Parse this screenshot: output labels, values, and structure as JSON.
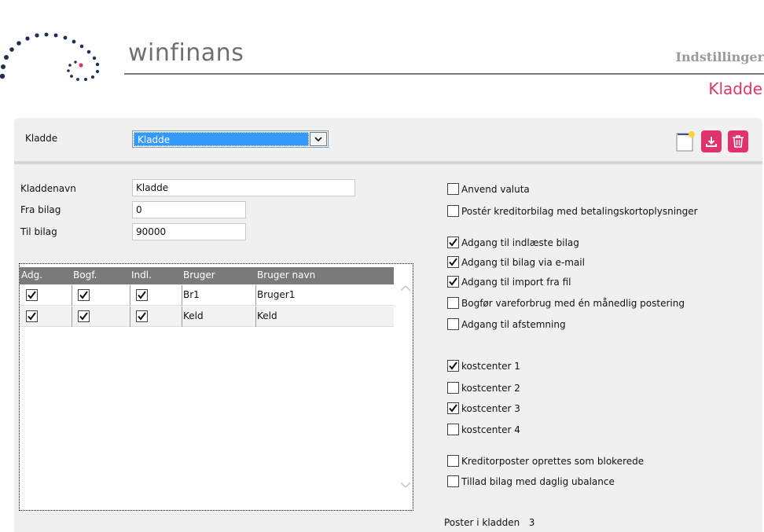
{
  "brand": {
    "name": "winfinans"
  },
  "header": {
    "section": "Indstillinger",
    "title": "Kladde"
  },
  "toolbar": {
    "kladde_label": "Kladde",
    "kladde_selected": "Kladde",
    "new_icon": "new-document-icon",
    "download_icon": "download-icon",
    "delete_icon": "trash-icon"
  },
  "form": {
    "name_label": "Kladdenavn",
    "name_value": "Kladde",
    "from_label": "Fra bilag",
    "from_value": "0",
    "to_label": "Til bilag",
    "to_value": "90000"
  },
  "table": {
    "columns": [
      "Adg.",
      "Bogf.",
      "Indl.",
      "Bruger",
      "Bruger navn"
    ],
    "rows": [
      {
        "adg": true,
        "bogf": true,
        "indl": true,
        "bruger": "Br1",
        "navn": "Bruger1"
      },
      {
        "adg": true,
        "bogf": true,
        "indl": true,
        "bruger": "Keld",
        "navn": "Keld"
      }
    ]
  },
  "options": {
    "group1": [
      {
        "label": "Anvend valuta",
        "checked": false
      },
      {
        "label": "Postér kreditorbilag med betalingskortoplysninger",
        "checked": false
      }
    ],
    "group2": [
      {
        "label": "Adgang til indlæste bilag",
        "checked": true
      },
      {
        "label": "Adgang til bilag via e-mail",
        "checked": true
      },
      {
        "label": "Adgang til import fra fil",
        "checked": true
      },
      {
        "label": "Bogfør vareforbrug med én månedlig postering",
        "checked": false
      },
      {
        "label": "Adgang til afstemning",
        "checked": false
      }
    ],
    "group3": [
      {
        "label": "kostcenter 1",
        "checked": true
      },
      {
        "label": "kostcenter 2",
        "checked": false
      },
      {
        "label": "kostcenter 3",
        "checked": true
      },
      {
        "label": "kostcenter 4",
        "checked": false
      }
    ],
    "group4": [
      {
        "label": "Kreditorposter oprettes som blokerede",
        "checked": false
      },
      {
        "label": "Tillad bilag med daglig ubalance",
        "checked": false
      }
    ]
  },
  "footer": {
    "count_label": "Poster i kladden",
    "count_value": "3"
  },
  "colors": {
    "accent": "#e0336e",
    "header_gray": "#7a7a7a",
    "selection": "#3399ff"
  }
}
